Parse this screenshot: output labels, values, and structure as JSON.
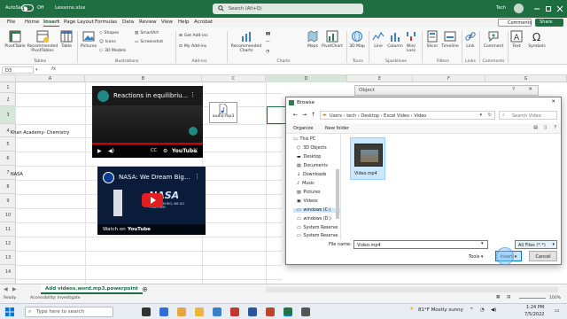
{
  "titlebar": {
    "autosave": "AutoSave",
    "autosave_state": "Off",
    "filename": "Lessons.xlsx",
    "search_placeholder": "Search (Alt+Q)",
    "user": "Tech"
  },
  "menu": {
    "tabs": [
      "File",
      "Home",
      "Insert",
      "Page Layout",
      "Formulas",
      "Data",
      "Review",
      "View",
      "Help",
      "Acrobat"
    ],
    "active": "Insert",
    "comments": "Comments",
    "share": "Share"
  },
  "ribbon": {
    "pivottable": "PivotTable",
    "recommended_pivot": "Recommended PivotTables",
    "table": "Table",
    "tables_group": "Tables",
    "pictures": "Pictures",
    "shapes": "Shapes",
    "icons": "Icons",
    "models3d": "3D Models",
    "smartart": "SmartArt",
    "screenshot": "Screenshot",
    "illustrations_group": "Illustrations",
    "get_addins": "Get Add-ins",
    "my_addins": "My Add-ins",
    "addins_group": "Add-ins",
    "recommended_charts": "Recommended Charts",
    "charts_group": "Charts",
    "maps": "Maps",
    "pivotchart": "PivotChart",
    "map3d": "3D Map",
    "tours_group": "Tours",
    "line": "Line",
    "column": "Column",
    "winloss": "Win/ Loss",
    "sparklines_group": "Sparklines",
    "slicer": "Slicer",
    "timeline": "Timeline",
    "filters_group": "Filters",
    "link": "Link",
    "links_group": "Links",
    "comment": "Comment",
    "comments_group": "Comments",
    "text": "Text",
    "symbols": "Symbols"
  },
  "formula": {
    "namebox": "D3",
    "fx": "fx",
    "value": ""
  },
  "grid": {
    "columns": [
      "A",
      "B",
      "C",
      "D",
      "E",
      "F",
      "G"
    ],
    "rows": [
      "1",
      "2",
      "3",
      "4",
      "5",
      "6",
      "7",
      "8",
      "9",
      "10",
      "11",
      "12",
      "13",
      "14"
    ],
    "cells": {
      "a4": "Khan Academy- Chemistry",
      "a7": "NASA"
    },
    "audio_label": "audio.mp3"
  },
  "videos": {
    "video1": {
      "title": "Reactions in equilibriu...",
      "brand": "YouTube"
    },
    "video2": {
      "title": "NASA: We Dream Big...",
      "watch_on": "Watch on",
      "brand": "YouTube",
      "overlay_top": "NASA",
      "overlay_bottom": "WE DREAM BIG, WE GO TOGETHER"
    }
  },
  "sheets": {
    "active": "Add videos.word.mp3.powerpoint"
  },
  "status": {
    "ready": "Ready",
    "accessibility": "Accessibility: Investigate",
    "zoom": "100%"
  },
  "object_dialog": {
    "title": "Object"
  },
  "browse": {
    "title": "Browse",
    "path": [
      "Users",
      "tech",
      "Desktop",
      "Excel Video",
      "Video"
    ],
    "search_placeholder": "Search Video",
    "organize": "Organize",
    "new_folder": "New folder",
    "nav": [
      "This PC",
      "3D Objects",
      "Desktop",
      "Documents",
      "Downloads",
      "Music",
      "Pictures",
      "Videos",
      "windows (C:)",
      "windows (D:)",
      "System Reserve",
      "System Reserve"
    ],
    "selected_nav": "windows (C:)",
    "file": "Video.mp4",
    "file_name_label": "File name:",
    "file_name_value": "Video.mp4",
    "file_type": "All Files (*.*)",
    "tools": "Tools",
    "insert": "Insert",
    "cancel": "Cancel"
  },
  "taskbar": {
    "search": "Type here to search",
    "weather": "81°F Mostly sunny",
    "time": "1:24 PM",
    "date": "7/5/2022"
  }
}
